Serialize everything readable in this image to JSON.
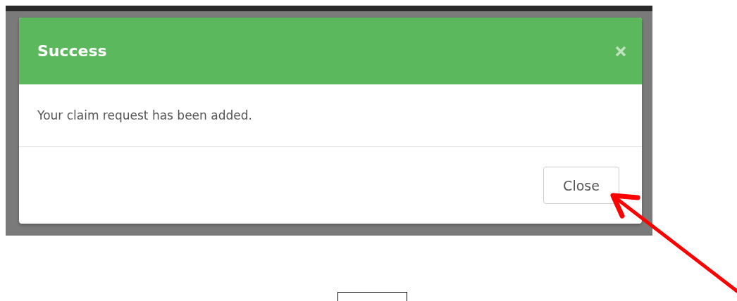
{
  "dialog": {
    "title": "Success",
    "message": "Your claim request has been added.",
    "buttons": [
      "Close"
    ]
  }
}
